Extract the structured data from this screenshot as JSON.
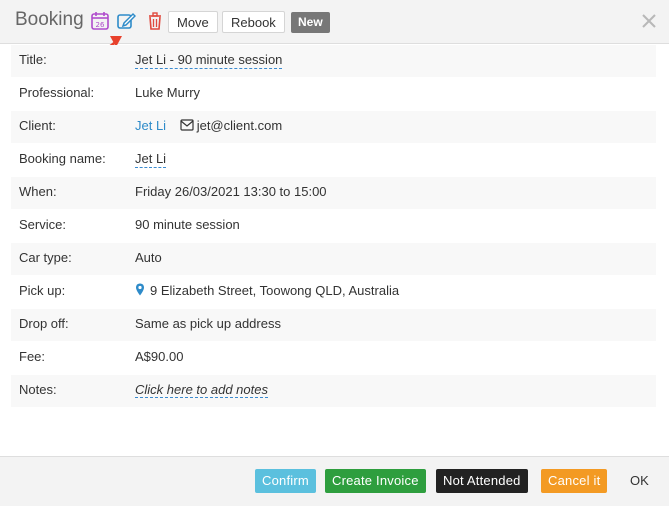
{
  "header": {
    "title": "Booking",
    "calendar_day": "26",
    "move_label": "Move",
    "rebook_label": "Rebook",
    "badge_label": "New"
  },
  "colors": {
    "calendar_icon": "#b04ccc",
    "edit_icon": "#2e8bc9",
    "delete_icon": "#e04a3f",
    "confirm": "#5bc0de",
    "create_invoice": "#2e9e3e",
    "not_attended": "#222222",
    "cancel": "#f39a23",
    "annotation_arrow": "#e8412c"
  },
  "fields": {
    "title": {
      "label": "Title:",
      "value": "Jet Li - 90 minute session"
    },
    "professional": {
      "label": "Professional:",
      "value": "Luke Murry"
    },
    "client": {
      "label": "Client:",
      "value": "Jet Li",
      "email": "jet@client.com"
    },
    "booking_name": {
      "label": "Booking name:",
      "value": "Jet Li"
    },
    "when": {
      "label": "When:",
      "value": "Friday 26/03/2021 13:30 to 15:00"
    },
    "service": {
      "label": "Service:",
      "value": "90 minute session"
    },
    "car_type": {
      "label": "Car type:",
      "value": "Auto"
    },
    "pick_up": {
      "label": "Pick up:",
      "value": "9 Elizabeth Street, Toowong QLD, Australia"
    },
    "drop_off": {
      "label": "Drop off:",
      "value": "Same as pick up address"
    },
    "fee": {
      "label": "Fee:",
      "value": "A$90.00"
    },
    "notes": {
      "label": "Notes:",
      "placeholder": "Click here to add notes"
    }
  },
  "footer": {
    "confirm_label": "Confirm",
    "create_invoice_label": "Create Invoice",
    "not_attended_label": "Not Attended",
    "cancel_label": "Cancel it",
    "ok_label": "OK"
  }
}
